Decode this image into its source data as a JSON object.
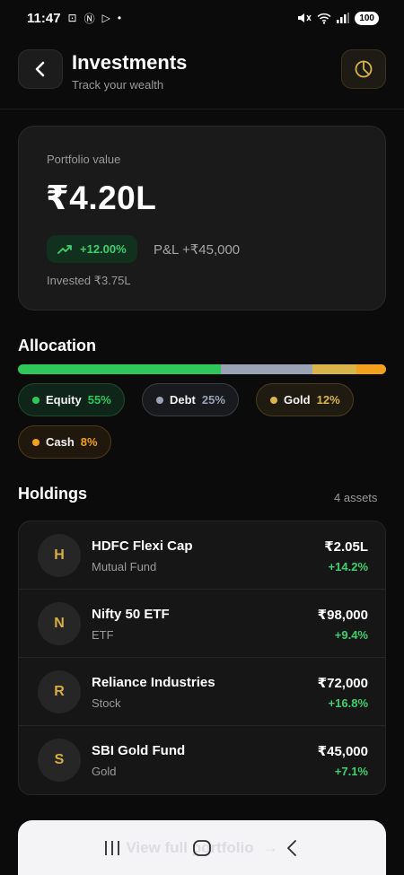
{
  "status_bar": {
    "time": "11:47",
    "battery": "100"
  },
  "header": {
    "title": "Investments",
    "subtitle": "Track your wealth"
  },
  "portfolio": {
    "label": "Portfolio value",
    "value": "₹4.20L",
    "return_pct": "+12.00%",
    "pnl": "P&L +₹45,000",
    "invested": "Invested ₹3.75L"
  },
  "allocation": {
    "title": "Allocation",
    "items": [
      {
        "label": "Equity",
        "pct": "55%",
        "fraction": 0.55,
        "color": "#2fc75a"
      },
      {
        "label": "Debt",
        "pct": "25%",
        "fraction": 0.25,
        "color": "#9aa3b5"
      },
      {
        "label": "Gold",
        "pct": "12%",
        "fraction": 0.12,
        "color": "#d9b44a"
      },
      {
        "label": "Cash",
        "pct": "8%",
        "fraction": 0.08,
        "color": "#f2a11e"
      }
    ]
  },
  "holdings": {
    "title": "Holdings",
    "count": "4 assets",
    "items": [
      {
        "initial": "H",
        "name": "HDFC Flexi Cap",
        "type": "Mutual Fund",
        "value": "₹2.05L",
        "change": "+14.2%"
      },
      {
        "initial": "N",
        "name": "Nifty 50 ETF",
        "type": "ETF",
        "value": "₹98,000",
        "change": "+9.4%"
      },
      {
        "initial": "R",
        "name": "Reliance Industries",
        "type": "Stock",
        "value": "₹72,000",
        "change": "+16.8%"
      },
      {
        "initial": "S",
        "name": "SBI Gold Fund",
        "type": "Gold",
        "value": "₹45,000",
        "change": "+7.1%"
      }
    ]
  },
  "cta": {
    "label": "View full portfolio"
  },
  "colors": {
    "accent": "#d9b44a",
    "positive": "#3ecf6e"
  }
}
